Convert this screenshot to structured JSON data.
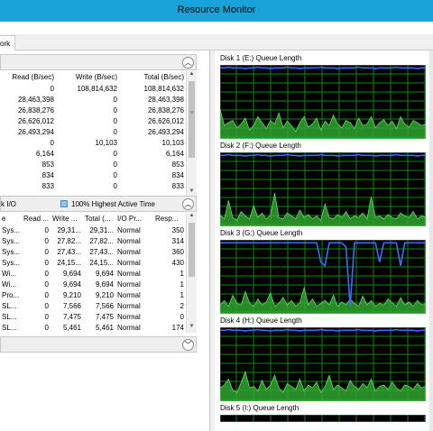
{
  "window": {
    "title": "Resource Monitor"
  },
  "tabs": [
    {
      "label": "ork"
    }
  ],
  "disk_activity": {
    "columns": [
      "Read (B/sec)",
      "Write (B/sec)",
      "Total (B/sec)"
    ],
    "rows": [
      [
        "0",
        "108,814,632",
        "108,814,632"
      ],
      [
        "28,463,398",
        "0",
        "28,463,398"
      ],
      [
        "26,838,276",
        "0",
        "26,838,276"
      ],
      [
        "26,626,012",
        "0",
        "26,626,012"
      ],
      [
        "26,493,294",
        "0",
        "26,493,294"
      ],
      [
        "0",
        "10,103",
        "10,103"
      ],
      [
        "6,164",
        "0",
        "6,164"
      ],
      [
        "853",
        "0",
        "853"
      ],
      [
        "834",
        "0",
        "834"
      ],
      [
        "833",
        "0",
        "833"
      ]
    ]
  },
  "storage": {
    "title": "k I/O",
    "legend": "100% Highest Active Time",
    "columns": [
      "e",
      "Read ...",
      "Write ...",
      "Total (...",
      "I/O Pr...",
      "Resp..."
    ],
    "rows": [
      [
        "Sys...",
        "0",
        "29,31...",
        "29,31...",
        "Normal",
        "350"
      ],
      [
        "Sys...",
        "0",
        "27,82...",
        "27,82...",
        "Normal",
        "314"
      ],
      [
        "Sys...",
        "0",
        "27,43...",
        "27,43...",
        "Normal",
        "360"
      ],
      [
        "Sys...",
        "0",
        "24,15...",
        "24,15...",
        "Normal",
        "430"
      ],
      [
        "Wi...",
        "0",
        "9,694",
        "9,694",
        "Normal",
        "1"
      ],
      [
        "Wi...",
        "0",
        "9,694",
        "9,694",
        "Normal",
        "1"
      ],
      [
        "Pro...",
        "0",
        "9,210",
        "9,210",
        "Normal",
        "1"
      ],
      [
        "SL...",
        "0",
        "7,566",
        "7,566",
        "Normal",
        "2"
      ],
      [
        "SL...",
        "0",
        "7,475",
        "7,475",
        "Normal",
        "0"
      ],
      [
        "SL...",
        "0",
        "5,461",
        "5,461",
        "Normal",
        "174"
      ]
    ]
  },
  "icons": {
    "collapse": "chevron-up-icon",
    "expand": "chevron-down-icon",
    "sort": "sort-desc-icon"
  },
  "graphs": [
    {
      "title": "Disk 1 (E:) Queue Length",
      "blue": [
        96,
        96,
        97,
        96,
        96,
        96,
        95,
        96,
        96,
        97,
        96,
        96,
        95,
        96,
        96,
        96,
        97,
        96,
        96,
        95,
        96,
        96,
        96,
        96,
        97,
        96,
        96,
        96,
        95,
        96,
        96,
        96,
        96,
        97,
        96,
        96,
        96,
        95,
        96,
        96,
        96,
        96,
        97,
        96,
        96,
        96,
        96,
        95,
        96,
        96
      ],
      "green": [
        40,
        18,
        22,
        25,
        15,
        20,
        28,
        12,
        18,
        30,
        22,
        14,
        25,
        20,
        35,
        15,
        24,
        18,
        10,
        22,
        30,
        16,
        20,
        28,
        12,
        24,
        18,
        32,
        20,
        15,
        25,
        22,
        14,
        28,
        18,
        20,
        30,
        15,
        22,
        26,
        18,
        24,
        14,
        30,
        20,
        16,
        25,
        22,
        18,
        20
      ]
    },
    {
      "title": "Disk 2 (F:) Queue Length",
      "blue": [
        96,
        96,
        97,
        96,
        96,
        96,
        95,
        96,
        96,
        97,
        96,
        96,
        95,
        96,
        96,
        96,
        97,
        96,
        96,
        95,
        96,
        96,
        96,
        96,
        97,
        96,
        96,
        96,
        95,
        96,
        96,
        96,
        96,
        97,
        96,
        96,
        96,
        95,
        96,
        96,
        96,
        96,
        97,
        96,
        96,
        96,
        96,
        95,
        96,
        96
      ],
      "green": [
        15,
        10,
        35,
        12,
        8,
        20,
        14,
        10,
        28,
        12,
        18,
        10,
        15,
        45,
        12,
        10,
        18,
        14,
        10,
        22,
        12,
        16,
        10,
        14,
        8,
        30,
        12,
        10,
        16,
        12,
        20,
        10,
        14,
        12,
        18,
        10,
        40,
        12,
        14,
        10,
        16,
        12,
        10,
        18,
        14,
        12,
        20,
        10,
        14,
        12
      ]
    },
    {
      "title": "Disk 3 (G:) Queue Length",
      "blue": [
        96,
        96,
        96,
        96,
        96,
        96,
        96,
        96,
        96,
        96,
        96,
        96,
        96,
        96,
        96,
        96,
        96,
        96,
        96,
        96,
        96,
        96,
        96,
        96,
        70,
        65,
        96,
        96,
        96,
        96,
        90,
        10,
        96,
        96,
        96,
        96,
        96,
        96,
        70,
        96,
        96,
        96,
        96,
        65,
        96,
        96,
        96,
        96,
        96,
        96
      ],
      "green": [
        12,
        18,
        10,
        25,
        14,
        12,
        30,
        15,
        10,
        20,
        12,
        16,
        28,
        10,
        14,
        22,
        12,
        18,
        10,
        15,
        35,
        12,
        20,
        10,
        14,
        18,
        12,
        25,
        10,
        16,
        12,
        20,
        14,
        10,
        24,
        12,
        18,
        10,
        14,
        12,
        20,
        15,
        10,
        22,
        12,
        16,
        10,
        18,
        12,
        14
      ]
    },
    {
      "title": "Disk 4 (H:) Queue Length",
      "blue": [
        96,
        96,
        97,
        96,
        96,
        96,
        95,
        96,
        96,
        97,
        96,
        96,
        95,
        96,
        96,
        96,
        97,
        96,
        96,
        95,
        96,
        96,
        96,
        96,
        97,
        96,
        96,
        96,
        95,
        96,
        96,
        96,
        96,
        97,
        96,
        96,
        96,
        95,
        96,
        96,
        96,
        96,
        97,
        96,
        96,
        96,
        96,
        95,
        96,
        96
      ],
      "green": [
        18,
        22,
        30,
        15,
        12,
        25,
        40,
        18,
        20,
        14,
        28,
        16,
        22,
        35,
        18,
        12,
        24,
        20,
        16,
        30,
        14,
        22,
        18,
        26,
        12,
        20,
        35,
        16,
        22,
        18,
        14,
        28,
        20,
        16,
        24,
        18,
        30,
        14,
        20,
        22,
        16,
        26,
        18,
        14,
        22,
        20,
        16,
        24,
        18,
        20
      ]
    },
    {
      "title": "Disk 5 (I:) Queue Length",
      "blue": [],
      "green": []
    }
  ]
}
